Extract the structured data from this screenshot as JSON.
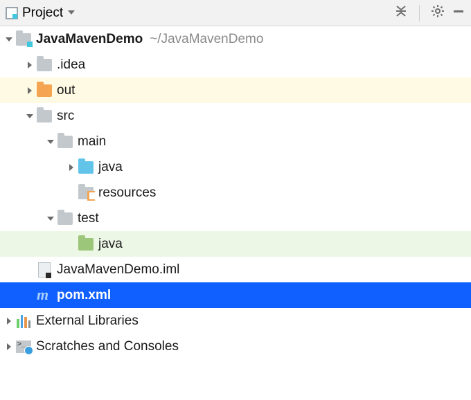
{
  "header": {
    "title": "Project"
  },
  "tree": {
    "root": {
      "name": "JavaMavenDemo",
      "path": "~/JavaMavenDemo"
    },
    "idea": "​.idea",
    "out": "out",
    "src": "src",
    "main": "main",
    "java_main": "java",
    "resources": "resources",
    "test": "test",
    "java_test": "java",
    "iml": "JavaMavenDemo.iml",
    "pom": "pom.xml",
    "external": "External Libraries",
    "scratches": "Scratches and Consoles"
  }
}
